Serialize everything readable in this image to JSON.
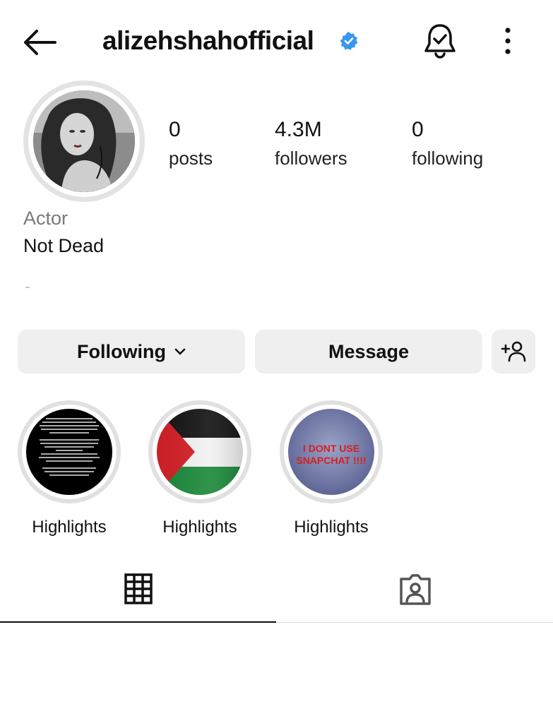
{
  "header": {
    "username": "alizehshahofficial",
    "verified": true,
    "icons": [
      "back-arrow-icon",
      "verified-badge-icon",
      "notification-bell-icon",
      "more-options-icon"
    ]
  },
  "profile": {
    "stats": [
      {
        "value": "0",
        "label": "posts"
      },
      {
        "value": "4.3M",
        "label": "followers"
      },
      {
        "value": "0",
        "label": "following"
      }
    ],
    "category": "Actor",
    "bio": "Not Dead"
  },
  "actions": {
    "following_label": "Following",
    "message_label": "Message",
    "add_user_icon": "add-person-icon"
  },
  "highlights": [
    {
      "label": "Highlights"
    },
    {
      "label": "Highlights"
    },
    {
      "label": "Highlights",
      "image_text": "I DONT USE SNAPCHAT !!!!"
    }
  ],
  "tabs": [
    {
      "icon": "grid-icon",
      "active": true
    },
    {
      "icon": "tagged-icon",
      "active": false
    }
  ],
  "colors": {
    "verified_blue": "#3897f0",
    "button_bg": "#efefef",
    "muted_text": "#7a7a7a"
  }
}
